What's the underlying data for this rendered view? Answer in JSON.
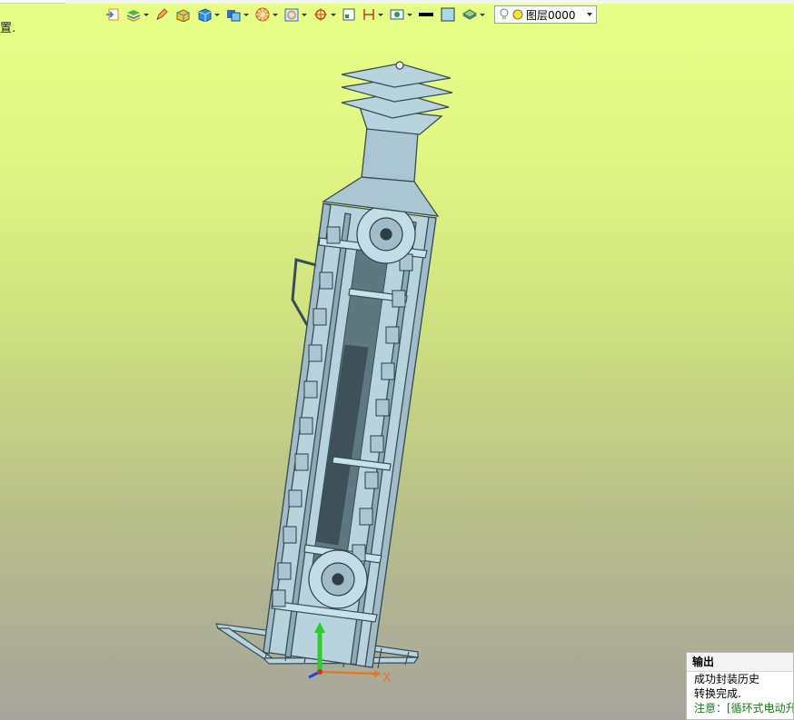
{
  "clipped_text": "置.",
  "toolbar": {
    "layer_value": "图层0000",
    "icons": [
      "import-icon",
      "layers-icon",
      "pencil-icon",
      "solid-box-icon",
      "blue-cube-icon",
      "shade-icon",
      "render-icon",
      "wireframe-icon",
      "snap-icon",
      "grid-icon",
      "dimension-icon",
      "display-mode-icon",
      "line-color-icon",
      "fill-color-icon",
      "layer-manager-icon",
      "lightbulb-icon"
    ]
  },
  "colors": {
    "model": "#b6d3de",
    "model_edge": "#3a4d55",
    "y_axis": "#2ecc2e",
    "x_axis": "#e0792a",
    "z_axis": "#2b3fd1"
  },
  "axes": {
    "x_label": "X"
  },
  "output": {
    "title": "输出",
    "lines": [
      "成功封装历史",
      "转换完成."
    ],
    "note": "注意：[循环式电动升"
  }
}
